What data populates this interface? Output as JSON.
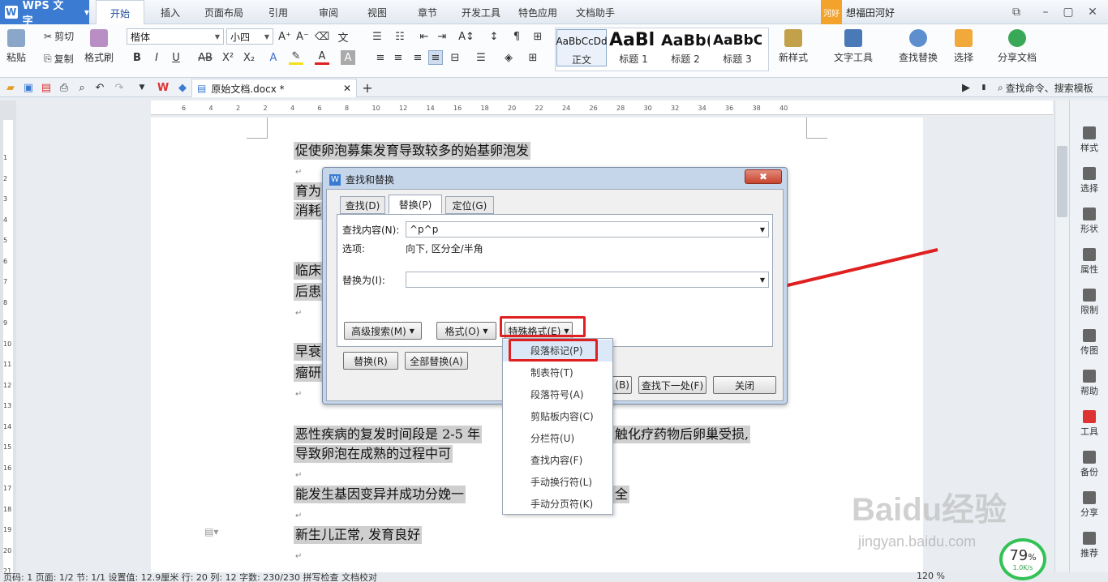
{
  "app": {
    "name": "WPS 文字",
    "logo": "W"
  },
  "menu": [
    "开始",
    "插入",
    "页面布局",
    "引用",
    "审阅",
    "视图",
    "章节",
    "开发工具",
    "特色应用",
    "文档助手"
  ],
  "user": {
    "tag": "河好",
    "name": "想福田河好"
  },
  "ribbon": {
    "paste": "粘贴",
    "cut": "剪切",
    "copy": "复制",
    "format_painter": "格式刷",
    "font_name": "楷体",
    "font_size": "小四",
    "styles": [
      {
        "preview": "AaBbCcDd",
        "label": "正文"
      },
      {
        "preview": "AaBl",
        "label": "标题 1"
      },
      {
        "preview": "AaBb(",
        "label": "标题 2"
      },
      {
        "preview": "AaBbC",
        "label": "标题 3"
      }
    ],
    "new_style": "新样式",
    "text_tools": "文字工具",
    "find_replace": "查找替换",
    "select": "选择",
    "share": "分享文档",
    "search_cmd": "查找命令、搜索模板"
  },
  "doc_tab": {
    "name": "原始文档.docx *"
  },
  "ruler_numbers": [
    "6",
    "4",
    "2",
    "2",
    "4",
    "6",
    "8",
    "10",
    "12",
    "14",
    "16",
    "18",
    "20",
    "22",
    "24",
    "26",
    "28",
    "30",
    "32",
    "34",
    "36",
    "38",
    "40"
  ],
  "vruler_numbers": [
    "1",
    "2",
    "3",
    "4",
    "5",
    "6",
    "7",
    "8",
    "9",
    "10",
    "11",
    "12",
    "13",
    "14",
    "15",
    "16",
    "17",
    "18",
    "19",
    "20",
    "21"
  ],
  "document": {
    "p1": "促使卵泡募集发育导致较多的始基卵泡发",
    "p2a": "育为",
    "p2b": "消耗",
    "p3a": "临床",
    "p3b": "后患",
    "p4a": "早衰",
    "p4b": "瘤研",
    "p5a": "恶性疾病的复发时间段是 2-5 年",
    "p5b": "触化疗药物后卵巢受损,",
    "p5c": "导致卵泡在成熟的过程中可",
    "p6a": "能发生基因变异并成功分娩一",
    "p6b": "全",
    "p7": "新生儿正常, 发育良好"
  },
  "dialog": {
    "title": "查找和替换",
    "close": "✖",
    "tabs": [
      "查找(D)",
      "替换(P)",
      "定位(G)"
    ],
    "find_label": "查找内容(N):",
    "find_value": "^p^p",
    "options_label": "选项:",
    "options_value": "向下, 区分全/半角",
    "replace_label": "替换为(I):",
    "replace_value": "",
    "btn_advanced": "高级搜索(M)",
    "btn_format": "格式(O)",
    "btn_special": "特殊格式(E)",
    "btn_replace": "替换(R)",
    "btn_replace_all": "全部替换(A)",
    "btn_prev_partial": "(B)",
    "btn_next": "查找下一处(F)",
    "btn_close": "关闭"
  },
  "special_menu": [
    "段落标记(P)",
    "制表符(T)",
    "段落符号(A)",
    "剪贴板内容(C)",
    "分栏符(U)",
    "查找内容(F)",
    "手动换行符(L)",
    "手动分页符(K)"
  ],
  "sidebar": [
    "样式",
    "选择",
    "形状",
    "属性",
    "限制",
    "传图",
    "帮助",
    "工具",
    "备份",
    "分享",
    "推荐"
  ],
  "status": {
    "text": "页码: 1  页面: 1/2  节: 1/1  设置值: 12.9厘米  行: 20  列: 12  字数: 230/230  拼写检查  文档校对",
    "zoom": "120 %"
  },
  "watermark": {
    "brand": "Baidu经验",
    "url": "jingyan.baidu.com"
  },
  "net_widget": {
    "percent": "79",
    "unit": "%",
    "speed": "1.0K/s"
  },
  "colors": {
    "accent": "#3b7bd1",
    "highlight": "#e02020"
  }
}
